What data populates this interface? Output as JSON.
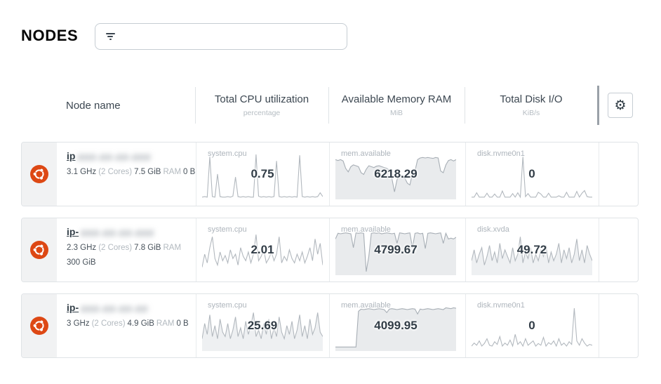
{
  "page": {
    "title": "NODES"
  },
  "search": {
    "placeholder": "",
    "value": ""
  },
  "table": {
    "columns": [
      {
        "label": "Node name",
        "sub": ""
      },
      {
        "label": "Total CPU utilization",
        "sub": "percentage"
      },
      {
        "label": "Available Memory RAM",
        "sub": "MiB"
      },
      {
        "label": "Total Disk I/O",
        "sub": "KiB/s"
      }
    ],
    "settings_icon": "gear-icon",
    "settings_glyph": "⚙"
  },
  "colors": {
    "accent_ubuntu": "#dd4814",
    "line_stroke": "#b2b8be",
    "area_stroke": "#a7aeb5",
    "area_fill": "#e9ebed",
    "linefill_fill": "#eef0f2",
    "value_text": "#323d47",
    "muted_text": "#b2b9bf"
  },
  "nodes": [
    {
      "os": "ubuntu",
      "hostname_prefix": "ip",
      "hostname_redacted": "###-##-##-###",
      "specs_line1": [
        {
          "text": "3.1 GHz",
          "muted": false
        },
        {
          "text": "(2 Cores)",
          "muted": true
        },
        {
          "text": "7.5 GiB",
          "muted": false
        },
        {
          "text": "RAM",
          "muted": true
        },
        {
          "text": "0 B",
          "muted": false
        }
      ],
      "specs_line2": [],
      "charts": [
        {
          "label": "system.cpu",
          "value": "0.75",
          "type": "line",
          "points": [
            2,
            3,
            2,
            95,
            3,
            2,
            55,
            3,
            2,
            2,
            3,
            2,
            4,
            48,
            3,
            2,
            3,
            2,
            3,
            2,
            2,
            100,
            4,
            2,
            3,
            2,
            3,
            2,
            3,
            85,
            3,
            2,
            3,
            2,
            3,
            2,
            3,
            2,
            98,
            3,
            2,
            3,
            2,
            3,
            2,
            3,
            12,
            3
          ]
        },
        {
          "label": "mem.available",
          "value": "6218.29",
          "type": "area",
          "points": [
            88,
            86,
            88,
            85,
            68,
            60,
            72,
            76,
            74,
            72,
            58,
            54,
            66,
            74,
            72,
            70,
            73,
            74,
            72,
            70,
            68,
            64,
            45,
            14,
            42,
            52,
            50,
            46,
            34,
            30,
            56,
            62,
            88,
            92,
            93,
            92,
            93,
            92,
            91,
            93,
            92,
            62,
            58,
            76,
            86,
            88,
            85,
            88
          ]
        },
        {
          "label": "disk.nvme0n1",
          "value": "0",
          "type": "line",
          "points": [
            2,
            2,
            12,
            2,
            2,
            2,
            11,
            2,
            2,
            9,
            2,
            2,
            16,
            2,
            2,
            2,
            10,
            2,
            12,
            2,
            95,
            3,
            10,
            2,
            2,
            2,
            13,
            9,
            2,
            2,
            11,
            2,
            2,
            2,
            5,
            2,
            2,
            13,
            2,
            2,
            2,
            15,
            2,
            11,
            17,
            3,
            2,
            2
          ]
        }
      ]
    },
    {
      "os": "ubuntu",
      "hostname_prefix": "ip-",
      "hostname_redacted": "###-##-##-###",
      "specs_line1": [
        {
          "text": "2.3 GHz",
          "muted": false
        },
        {
          "text": "(2 Cores)",
          "muted": true
        },
        {
          "text": "7.8 GiB",
          "muted": false
        },
        {
          "text": "RAM",
          "muted": true
        }
      ],
      "specs_line2": [
        {
          "text": "300 GiB",
          "muted": false
        }
      ],
      "charts": [
        {
          "label": "system.cpu",
          "value": "2.01",
          "type": "line",
          "points": [
            15,
            45,
            25,
            60,
            85,
            35,
            20,
            50,
            30,
            42,
            25,
            55,
            35,
            45,
            20,
            60,
            40,
            30,
            50,
            25,
            45,
            90,
            30,
            40,
            55,
            25,
            35,
            50,
            30,
            45,
            85,
            25,
            40,
            30,
            55,
            35,
            25,
            45,
            30,
            50,
            25,
            40,
            60,
            30,
            80,
            45,
            70,
            20
          ]
        },
        {
          "label": "mem.available",
          "value": "4799.67",
          "type": "area",
          "points": [
            80,
            93,
            92,
            93,
            94,
            93,
            92,
            60,
            94,
            93,
            94,
            93,
            5,
            40,
            93,
            94,
            93,
            94,
            92,
            93,
            94,
            93,
            92,
            93,
            70,
            94,
            93,
            92,
            93,
            94,
            60,
            93,
            94,
            92,
            93,
            58,
            93,
            94,
            93,
            92,
            93,
            94,
            70,
            93,
            80,
            82,
            80,
            84
          ]
        },
        {
          "label": "disk.xvda",
          "value": "49.72",
          "type": "linefill",
          "points": [
            30,
            55,
            25,
            45,
            60,
            20,
            40,
            65,
            30,
            50,
            25,
            70,
            35,
            55,
            40,
            25,
            60,
            30,
            45,
            85,
            25,
            50,
            35,
            60,
            25,
            45,
            30,
            55,
            40,
            65,
            25,
            50,
            30,
            45,
            70,
            25,
            55,
            35,
            60,
            25,
            45,
            80,
            30,
            55,
            25,
            65,
            45,
            30
          ]
        }
      ]
    },
    {
      "os": "ubuntu",
      "hostname_prefix": "ip-",
      "hostname_redacted": "###-##-##-##",
      "specs_line1": [
        {
          "text": "3 GHz",
          "muted": false
        },
        {
          "text": "(2 Cores)",
          "muted": true
        },
        {
          "text": "4.9 GiB",
          "muted": false
        },
        {
          "text": "RAM",
          "muted": true
        },
        {
          "text": "0 B",
          "muted": false
        }
      ],
      "specs_line2": [],
      "charts": [
        {
          "label": "system.cpu",
          "value": "25.69",
          "type": "linefill",
          "points": [
            25,
            60,
            35,
            80,
            30,
            55,
            25,
            70,
            40,
            30,
            60,
            25,
            45,
            75,
            30,
            50,
            25,
            65,
            35,
            55,
            85,
            30,
            45,
            25,
            60,
            35,
            70,
            25,
            50,
            30,
            75,
            40,
            25,
            55,
            35,
            65,
            25,
            45,
            80,
            30,
            55,
            25,
            70,
            35,
            50,
            85,
            40,
            30
          ]
        },
        {
          "label": "mem.available",
          "value": "4099.95",
          "type": "area",
          "points": [
            6,
            6,
            6,
            6,
            6,
            6,
            6,
            6,
            6,
            88,
            93,
            92,
            93,
            94,
            93,
            92,
            93,
            94,
            93,
            92,
            85,
            93,
            94,
            93,
            92,
            93,
            94,
            93,
            92,
            93,
            94,
            93,
            82,
            93,
            92,
            93,
            94,
            93,
            92,
            93,
            94,
            93,
            92,
            96,
            95,
            94,
            96,
            95
          ]
        },
        {
          "label": "disk.nvme0n1",
          "value": "0",
          "type": "line",
          "points": [
            8,
            15,
            10,
            20,
            8,
            14,
            25,
            10,
            8,
            18,
            12,
            30,
            8,
            15,
            10,
            22,
            8,
            35,
            12,
            18,
            8,
            25,
            10,
            15,
            20,
            8,
            14,
            10,
            28,
            8,
            16,
            12,
            20,
            8,
            25,
            10,
            15,
            8,
            18,
            12,
            95,
            20,
            10,
            25,
            15,
            8,
            12,
            10
          ]
        }
      ]
    }
  ]
}
